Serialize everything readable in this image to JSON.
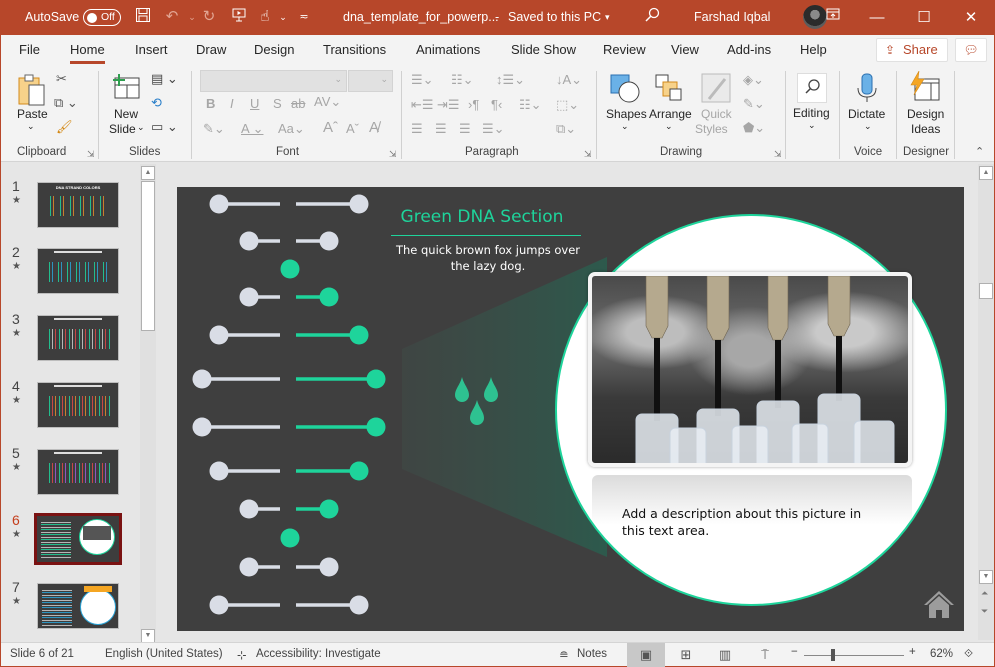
{
  "titlebar": {
    "autosave_label": "AutoSave",
    "autosave_state": "Off",
    "filename": "dna_template_for_powerp...",
    "save_status": "Saved to this PC",
    "user_name": "Farshad Iqbal",
    "icons": [
      "save-icon",
      "undo-icon",
      "redo-icon",
      "present-from-start-icon",
      "touch-mode-icon",
      "customize-qat-icon",
      "search-icon",
      "ribbon-display-icon",
      "minimize-icon",
      "maximize-icon",
      "close-icon"
    ]
  },
  "tabs": {
    "items": [
      "File",
      "Home",
      "Insert",
      "Draw",
      "Design",
      "Transitions",
      "Animations",
      "Slide Show",
      "Review",
      "View",
      "Add-ins",
      "Help"
    ],
    "active": "Home",
    "share_label": "Share"
  },
  "ribbon": {
    "clipboard": {
      "label": "Clipboard",
      "paste": "Paste"
    },
    "slides": {
      "label": "Slides",
      "new_slide_1": "New",
      "new_slide_2": "Slide"
    },
    "font": {
      "label": "Font",
      "font_name": "",
      "font_size": ""
    },
    "paragraph": {
      "label": "Paragraph"
    },
    "drawing": {
      "label": "Drawing",
      "shapes": "Shapes",
      "arrange": "Arrange",
      "quick_styles_1": "Quick",
      "quick_styles_2": "Styles"
    },
    "editing": {
      "label": "Editing"
    },
    "voice": {
      "label": "Voice",
      "dictate": "Dictate"
    },
    "designer": {
      "label": "Designer",
      "design_ideas_1": "Design",
      "design_ideas_2": "Ideas"
    }
  },
  "thumbnails": {
    "items": [
      {
        "number": "1",
        "title": "DNA STRAND COLORS"
      },
      {
        "number": "2",
        "title": ""
      },
      {
        "number": "3",
        "title": ""
      },
      {
        "number": "4",
        "title": ""
      },
      {
        "number": "5",
        "title": ""
      },
      {
        "number": "6",
        "title": ""
      },
      {
        "number": "7",
        "title": ""
      }
    ],
    "active": "6",
    "star_glyph": "★"
  },
  "slide": {
    "title": "Green DNA Section",
    "subtitle": "The quick brown fox jumps over the lazy dog.",
    "description": "Add a description about this picture in this text area.",
    "accent_color": "#1ed49b",
    "background_color": "#3f3f3f",
    "strand_color": "#d9dde6",
    "image_alt": "Lab pipettes dispensing into sample vials",
    "icons": [
      "water-drops-icon",
      "home-icon"
    ]
  },
  "statusbar": {
    "slide_counter": "Slide 6 of 21",
    "language": "English (United States)",
    "accessibility": "Accessibility: Investigate",
    "notes": "Notes",
    "zoom_percent": "62%",
    "zoom_level": 0.62
  }
}
